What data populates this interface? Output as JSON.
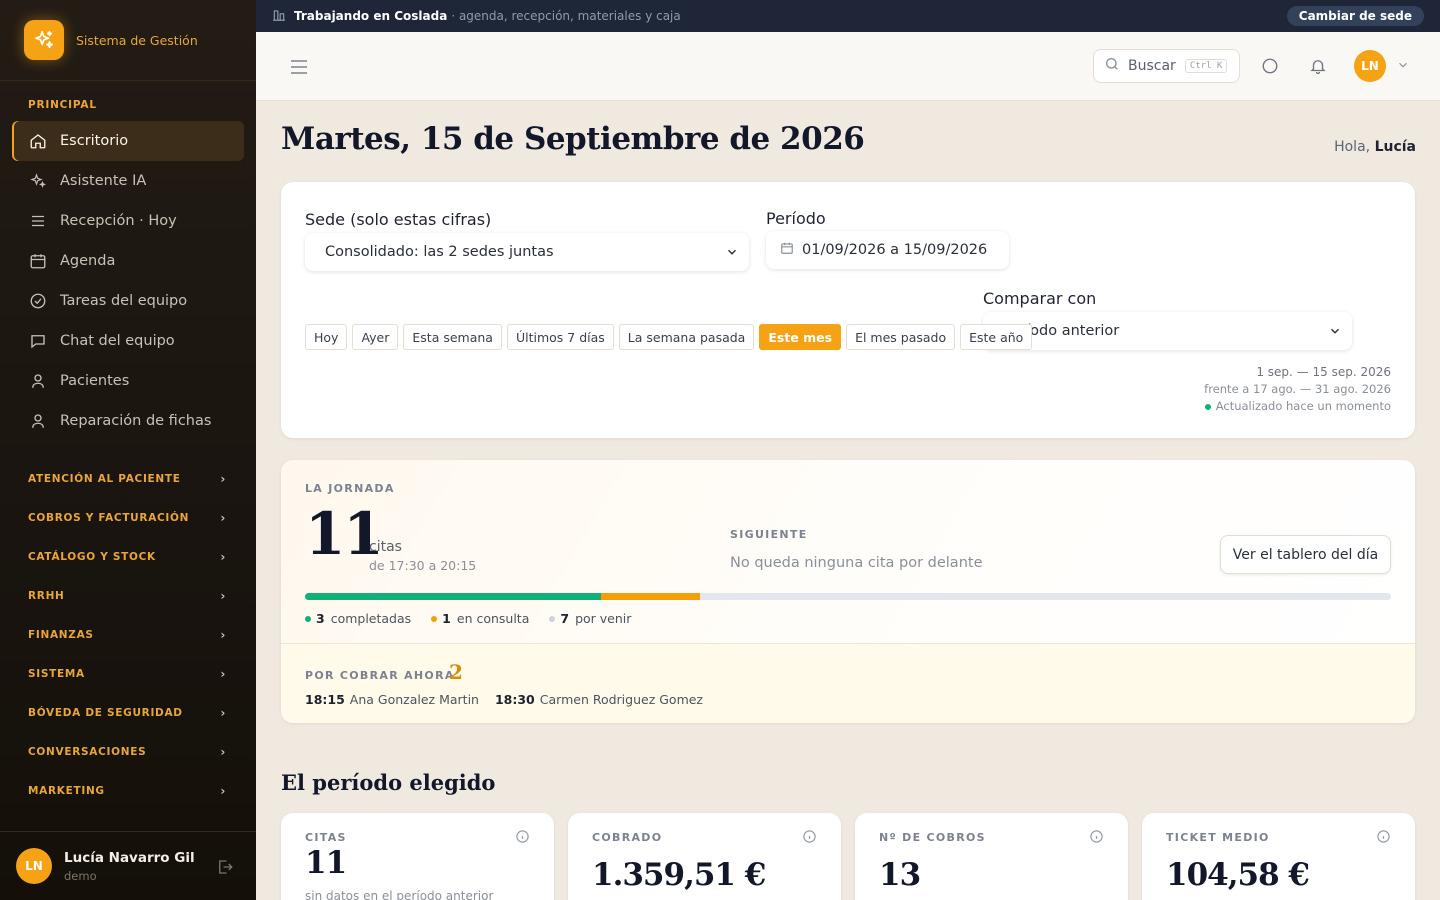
{
  "brand": {
    "name": "Sistema de Gestión"
  },
  "sidebar": {
    "section": "PRINCIPAL",
    "items": [
      {
        "label": "Escritorio",
        "icon": "home-icon"
      },
      {
        "label": "Asistente IA",
        "icon": "sparkles-icon"
      },
      {
        "label": "Recepción · Hoy",
        "icon": "list-icon"
      },
      {
        "label": "Agenda",
        "icon": "calendar-icon"
      },
      {
        "label": "Tareas del equipo",
        "icon": "check-circle-icon"
      },
      {
        "label": "Chat del equipo",
        "icon": "chat-icon"
      },
      {
        "label": "Pacientes",
        "icon": "user-icon"
      },
      {
        "label": "Reparación de fichas",
        "icon": "user-icon"
      }
    ],
    "groups": [
      "ATENCIÓN AL PACIENTE",
      "COBROS Y FACTURACIÓN",
      "CATÁLOGO Y STOCK",
      "RRHH",
      "FINANZAS",
      "SISTEMA",
      "BÓVEDA DE SEGURIDAD",
      "CONVERSACIONES",
      "MARKETING"
    ],
    "user": {
      "initials": "LN",
      "name": "Lucía Navarro Gil",
      "role": "demo"
    }
  },
  "topbar": {
    "working_prefix": "Trabajando en",
    "site": "Coslada",
    "description": "· agenda, recepción, materiales y caja",
    "switch_label": "Cambiar de sede"
  },
  "header": {
    "search_label": "Buscar",
    "shortcut": "Ctrl K",
    "avatar_initials": "LN"
  },
  "page": {
    "title": "Martes, 15 de Septiembre de 2026",
    "greeting": "Hola,",
    "user_first": "Lucía"
  },
  "filters": {
    "site_label": "Sede (solo estas cifras)",
    "site_value": "Consolidado: las 2 sedes juntas",
    "period_label": "Período",
    "period_value": "01/09/2026 a 15/09/2026",
    "compare_label": "Comparar con",
    "compare_value": "Período anterior",
    "chips": [
      "Hoy",
      "Ayer",
      "Esta semana",
      "Últimos 7 días",
      "La semana pasada",
      "Este mes",
      "El mes pasado",
      "Este año"
    ],
    "selected_chip": "Este mes",
    "range": "1 sep. — 15 sep. 2026",
    "compare_range": "frente a 17 ago. — 31 ago. 2026",
    "updated": "Actualizado hace un momento"
  },
  "jornada": {
    "kicker": "LA JORNADA",
    "count": "11",
    "count_label": "citas",
    "time_range": "de 17:30 a 20:15",
    "next_kicker": "SIGUIENTE",
    "next_value": "No queda ninguna cita por delante",
    "board_button": "Ver el tablero del día",
    "total": 11,
    "legend": [
      {
        "count": "3",
        "label": "completadas",
        "value": 3,
        "color": "#12b076"
      },
      {
        "count": "1",
        "label": "en consulta",
        "value": 1,
        "color": "#f59e0b"
      },
      {
        "count": "7",
        "label": "por venir",
        "value": 7,
        "color": "#cfd4dc"
      }
    ],
    "cobrar_kicker": "POR COBRAR AHORA",
    "cobrar_count": "2",
    "cobrar_items": [
      {
        "time": "18:15",
        "name": "Ana Gonzalez Martin"
      },
      {
        "time": "18:30",
        "name": "Carmen Rodriguez Gomez"
      }
    ]
  },
  "period": {
    "title": "El período elegido",
    "stats": [
      {
        "kicker": "CITAS",
        "value": "11",
        "sub": "sin datos en el período anterior"
      },
      {
        "kicker": "COBRADO",
        "value": "1.359,51 €",
        "sub": ""
      },
      {
        "kicker": "Nº DE COBROS",
        "value": "13",
        "sub": ""
      },
      {
        "kicker": "TICKET MEDIO",
        "value": "104,58 €",
        "sub": ""
      }
    ]
  },
  "colors": {
    "accent": "#f5a214",
    "sidebar_bg": "#1c1610",
    "topbar_bg": "#1e2638",
    "success": "#12b076"
  }
}
